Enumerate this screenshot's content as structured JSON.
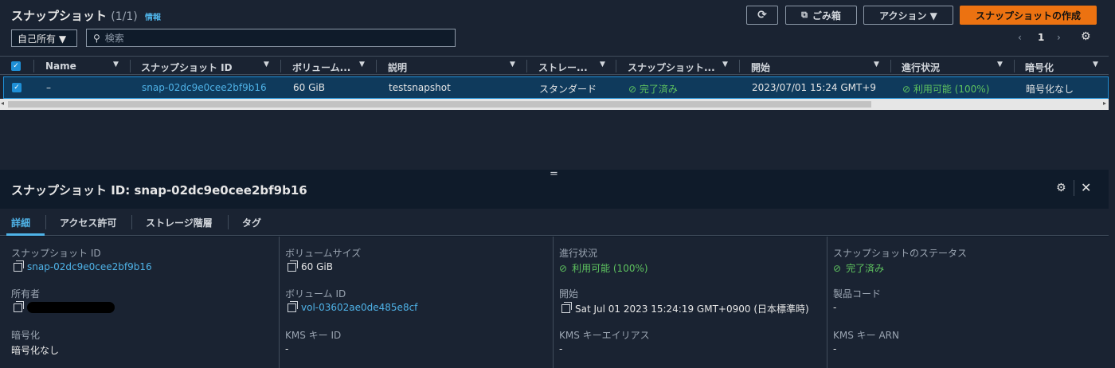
{
  "header": {
    "title": "スナップショット",
    "count": "(1/1)",
    "info": "情報",
    "refresh_label": "⟳",
    "trash_label": "ごみ箱",
    "actions_label": "アクション ▼",
    "create_label": "スナップショットの作成"
  },
  "filter": {
    "owner_select": "自己所有 ▼",
    "search_placeholder": "検索"
  },
  "pagination": {
    "page": "1"
  },
  "table": {
    "columns": [
      "Name",
      "スナップショット ID",
      "ボリューム...",
      "説明",
      "ストレー...",
      "スナップショット...",
      "開始",
      "進行状況",
      "暗号化"
    ],
    "rows": [
      {
        "name": "–",
        "snapshot_id": "snap-02dc9e0cee2bf9b16",
        "volume": "60 GiB",
        "description": "testsnapshot",
        "storage": "スタンダード",
        "status": "完了済み",
        "started": "2023/07/01 15:24 GMT+9",
        "progress": "利用可能 (100%)",
        "encryption": "暗号化なし"
      }
    ]
  },
  "detail": {
    "title": "スナップショット ID: snap-02dc9e0cee2bf9b16",
    "tabs": [
      "詳細",
      "アクセス許可",
      "ストレージ階層",
      "タグ"
    ],
    "fields": {
      "snapshot_id_label": "スナップショット ID",
      "snapshot_id_value": "snap-02dc9e0cee2bf9b16",
      "owner_label": "所有者",
      "encryption_label": "暗号化",
      "encryption_value": "暗号化なし",
      "volume_size_label": "ボリュームサイズ",
      "volume_size_value": "60 GiB",
      "volume_id_label": "ボリューム ID",
      "volume_id_value": "vol-03602ae0de485e8cf",
      "kms_key_id_label": "KMS キー ID",
      "kms_key_id_value": "-",
      "progress_label": "進行状況",
      "progress_value": "利用可能 (100%)",
      "started_label": "開始",
      "started_value": "Sat Jul 01 2023 15:24:19 GMT+0900 (日本標準時)",
      "kms_alias_label": "KMS キーエイリアス",
      "kms_alias_value": "-",
      "status_label": "スナップショットのステータス",
      "status_value": "完了済み",
      "product_code_label": "製品コード",
      "product_code_value": "-",
      "kms_arn_label": "KMS キー ARN",
      "kms_arn_value": "-"
    }
  }
}
